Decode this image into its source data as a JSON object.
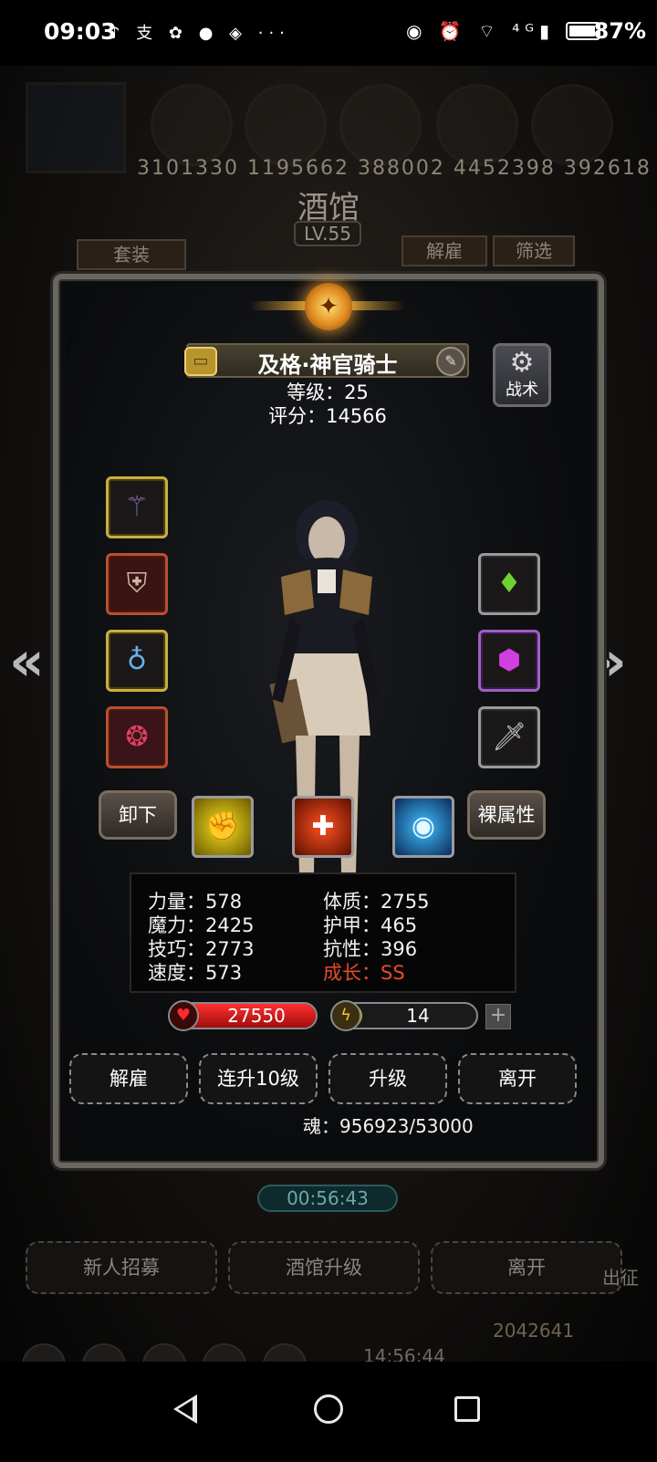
{
  "status_bar": {
    "time": "09:03",
    "left_icons": "♪ 支 ✿ ● ◈ ···",
    "right_icons": "◉ ⏰ ⌔ ⁴ᴳ▮",
    "battery": "87%"
  },
  "background": {
    "top_numbers": "3101330  1195662  388002  4452398  392618",
    "tavern_title": "酒馆",
    "tavern_level": "LV.55",
    "set_btn": "套装",
    "dismiss_btn": "解雇",
    "filter_btn": "筛选",
    "timer": "00:56:43",
    "bottom_buttons": [
      "新人招募",
      "酒馆升级",
      "离开"
    ],
    "side_label": "出征",
    "gold": "2042641",
    "clock": "14:56:44"
  },
  "dialog": {
    "hero_name": "及格·神官骑士",
    "level": "等级：25",
    "score": "评分：14566",
    "tactic_label": "战术",
    "unequip_label": "卸下",
    "naked_attr_label": "裸属性",
    "stats": {
      "strength": "力量：578",
      "magic": "魔力：2425",
      "skill": "技巧：2773",
      "speed": "速度：573",
      "constitution": "体质：2755",
      "armor": "护甲：465",
      "resist": "抗性：396",
      "growth": "成长：SS"
    },
    "hp": "27550",
    "hp_fill": 1.0,
    "energy": "14",
    "energy_fill": 0.2,
    "plus_label": "+",
    "footer_buttons": {
      "dismiss": "解雇",
      "levelup10": "连升10级",
      "levelup": "升级",
      "leave": "离开"
    },
    "soul": "魂：956923/53000"
  },
  "colors": {
    "growth_text": "#e84a2a",
    "hp_bar": "#d81818",
    "energy_bar": "#e0c020",
    "frame": "#6a6660"
  },
  "icons": {
    "equipment_left": [
      "staff-icon",
      "armor-icon",
      "amulet-icon",
      "ring-icon"
    ],
    "equipment_right": [
      "green-gem-icon",
      "purple-gem-icon",
      "dagger-icon"
    ],
    "skills": [
      "fist-skill-icon",
      "heal-cross-skill-icon",
      "eye-skill-icon"
    ]
  }
}
